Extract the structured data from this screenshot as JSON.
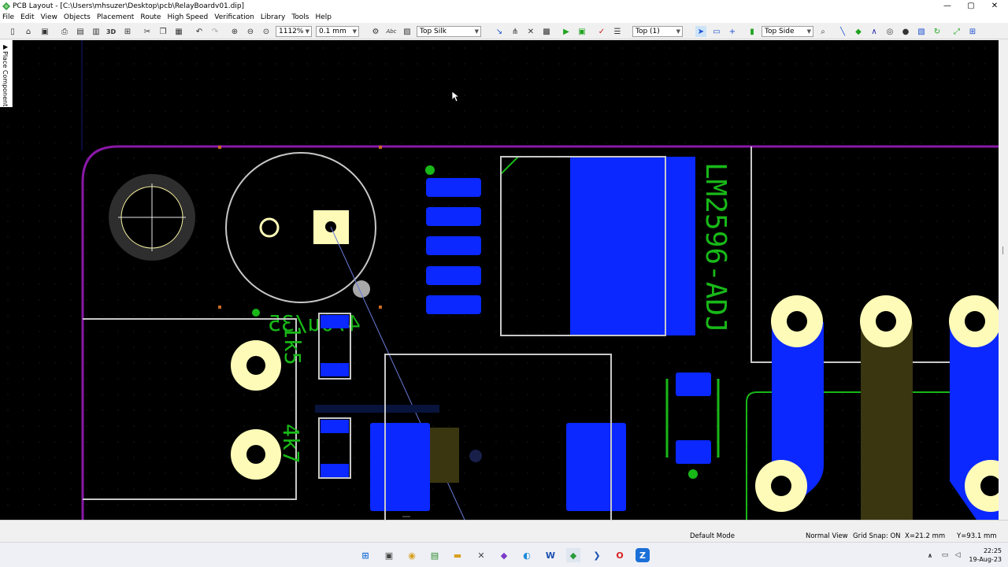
{
  "window": {
    "title": "PCB Layout - [C:\\Users\\mhsuzer\\Desktop\\pcb\\RelayBoardv01.dip]",
    "controls": {
      "minimize": "—",
      "maximize": "▢",
      "close": "✕"
    }
  },
  "menu": [
    "File",
    "Edit",
    "View",
    "Objects",
    "Placement",
    "Route",
    "High Speed",
    "Verification",
    "Library",
    "Tools",
    "Help"
  ],
  "toolbar": {
    "three_d_label": "3D",
    "zoom_value": "1112%",
    "grid_value": "0.1 mm",
    "layer_value": "Top Silk",
    "route_layer_value": "Top (1)",
    "side_value": "Top Side",
    "abc_label": "Abc"
  },
  "side_panel": {
    "label": "Place Component"
  },
  "pcb": {
    "component_labels": {
      "regulator": "LM2596-ADJ",
      "capacitor": "470u/35",
      "resistor1": "1k5",
      "resistor2": "4k7"
    },
    "colors": {
      "background": "#000000",
      "outline": "#8a18a8",
      "pad_blue": "#0a28ff",
      "silk_green": "#18b818",
      "through_hole": "#fefbb8",
      "silk_white": "#c8c8c8",
      "bottom_layer": "#3a3610"
    }
  },
  "status": {
    "mode": "Default Mode",
    "view": "Normal View",
    "grid_snap": "Grid Snap: ON",
    "x": "X=21.2 mm",
    "y": "Y=93.1 mm"
  },
  "taskbar": {
    "time": "22:25",
    "date": "19-Aug-23"
  }
}
